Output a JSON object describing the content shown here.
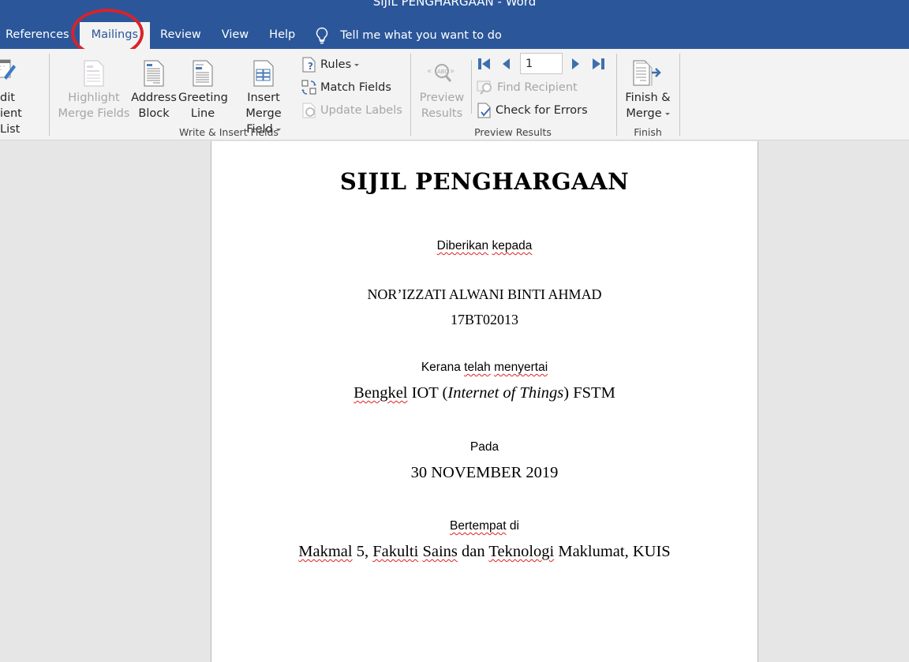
{
  "window": {
    "title": "SIJIL PENGHARGAAN  -  Word"
  },
  "tabs": [
    {
      "label": "References"
    },
    {
      "label": "Mailings",
      "active": true
    },
    {
      "label": "Review"
    },
    {
      "label": "View"
    },
    {
      "label": "Help"
    }
  ],
  "tell_me": {
    "label": "Tell me what you want to do",
    "icon": "lightbulb-icon"
  },
  "annotation": {
    "type": "circle",
    "target": "Mailings",
    "color": "#d8232a"
  },
  "ribbon": {
    "start_mail_merge": {
      "edit_recipient_list": {
        "line1": "dit",
        "line2": "ient List",
        "icon": "edit-recipient-list-icon"
      }
    },
    "write_insert_fields": {
      "label": "Write & Insert Fields",
      "highlight_merge_fields": {
        "line1": "Highlight",
        "line2": "Merge Fields",
        "disabled": true
      },
      "address_block": {
        "line1": "Address",
        "line2": "Block"
      },
      "greeting_line": {
        "line1": "Greeting",
        "line2": "Line"
      },
      "insert_merge_field": {
        "line1": "Insert Merge",
        "line2": "Field"
      },
      "rules": {
        "label": "Rules"
      },
      "match_fields": {
        "label": "Match Fields"
      },
      "update_labels": {
        "label": "Update Labels",
        "disabled": true
      }
    },
    "preview_results": {
      "label": "Preview Results",
      "preview_results_button": {
        "line1": "Preview",
        "line2": "Results",
        "disabled": true
      },
      "record_number": "1",
      "find_recipient": {
        "label": "Find Recipient",
        "disabled": true
      },
      "check_for_errors": {
        "label": "Check for Errors"
      }
    },
    "finish": {
      "label": "Finish",
      "finish_merge": {
        "line1": "Finish &",
        "line2": "Merge"
      }
    }
  },
  "colors": {
    "brand": "#2b579a",
    "ribbon_bg": "#f3f3f3",
    "nav_blue": "#3f6fad"
  },
  "document": {
    "title": "SIJIL PENGHARGAAN",
    "given_to_label": {
      "w1": "Diberikan",
      "w2": "kepada"
    },
    "recipient_name": "NOR’IZZATI ALWANI BINTI AHMAD",
    "student_id": "17BT02013",
    "reason_label": {
      "w1": "Kerana",
      "w2": "telah",
      "w3": "menyertai"
    },
    "event": {
      "w1": "Bengkel",
      "w2": " IOT (",
      "italic": "Internet of Things",
      "w3": ") FSTM"
    },
    "date_label": "Pada",
    "date": "30 NOVEMBER 2019",
    "venue_label": {
      "w1": "Bertempat",
      "w2": " di"
    },
    "venue": {
      "w1": "Makmal",
      "w2": " 5, ",
      "w3": "Fakulti",
      "w4": " ",
      "w5": "Sains",
      "w6": " dan ",
      "w7": "Teknologi",
      "w8": " Maklumat, KUIS"
    }
  }
}
